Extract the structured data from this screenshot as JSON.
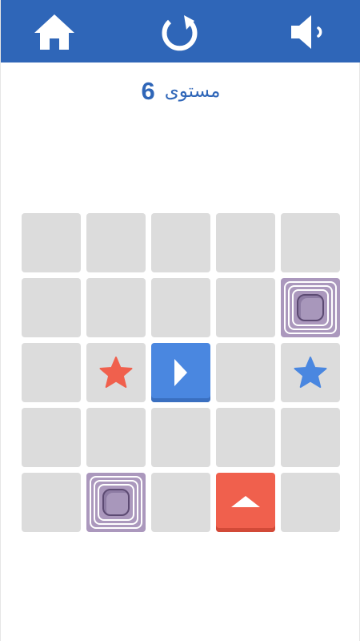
{
  "header": {
    "background_color": "#2f66b8",
    "buttons": [
      {
        "name": "home-button",
        "icon": "home-icon"
      },
      {
        "name": "restart-button",
        "icon": "restart-icon"
      },
      {
        "name": "sound-button",
        "icon": "sound-icon"
      }
    ]
  },
  "level": {
    "label": "مستوى",
    "number": "6"
  },
  "board": {
    "rows": 5,
    "cols": 5,
    "cell_color": "#dcdcdc",
    "pieces": [
      {
        "type": "blue-block",
        "row": 2,
        "col": 2,
        "arrow": "right",
        "color": "#4a87e0"
      },
      {
        "type": "red-block",
        "row": 4,
        "col": 3,
        "arrow": "up",
        "color": "#f0604d"
      }
    ],
    "targets": [
      {
        "type": "red-star",
        "row": 2,
        "col": 1,
        "color": "#f0604d"
      },
      {
        "type": "blue-star",
        "row": 2,
        "col": 4,
        "color": "#4a87e0"
      }
    ],
    "holes": [
      {
        "row": 1,
        "col": 4,
        "color": "#ab98bd"
      },
      {
        "row": 4,
        "col": 1,
        "color": "#ab98bd"
      }
    ]
  }
}
